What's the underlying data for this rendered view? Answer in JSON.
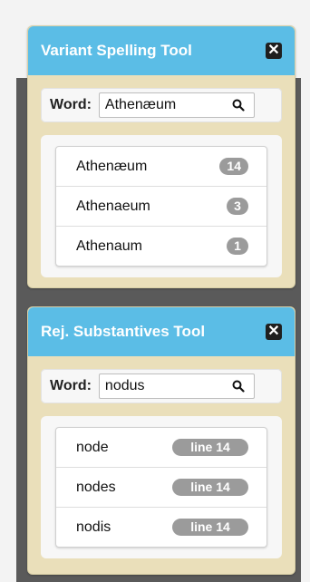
{
  "variant_tool": {
    "title": "Variant Spelling Tool",
    "close_label": "✕",
    "word_label": "Word:",
    "search_value": "Athenæum",
    "results": [
      {
        "word": "Athenæum",
        "count": "14"
      },
      {
        "word": "Athenaeum",
        "count": "3"
      },
      {
        "word": "Athenaum",
        "count": "1"
      }
    ]
  },
  "rej_tool": {
    "title": "Rej. Substantives Tool",
    "close_label": "✕",
    "word_label": "Word:",
    "search_value": "nodus",
    "results": [
      {
        "word": "node",
        "line": "line 14"
      },
      {
        "word": "nodes",
        "line": "line 14"
      },
      {
        "word": "nodis",
        "line": "line 14"
      }
    ]
  },
  "colors": {
    "header": "#5bbde6",
    "panel_bg": "#eadfba",
    "badge": "#9b9b9b",
    "backdrop": "#5a5a5a"
  },
  "icons": {
    "search": "search-icon",
    "close": "close-icon"
  }
}
